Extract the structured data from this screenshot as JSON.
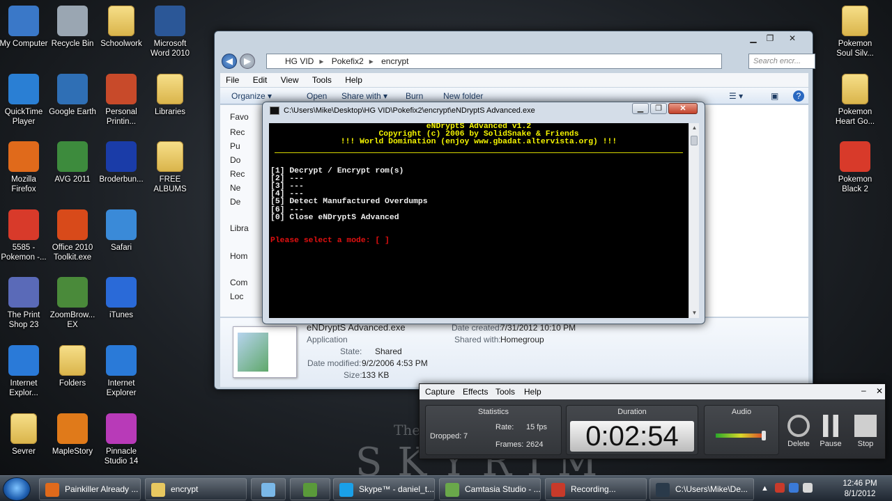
{
  "desktop": {
    "left_icons": [
      {
        "label": "My Computer",
        "color": "#3a78c8"
      },
      {
        "label": "Recycle Bin",
        "color": "#9aa6b2"
      },
      {
        "label": "Schoolwork",
        "color": "folder"
      },
      {
        "label": "Microsoft Word 2010",
        "color": "#2b5797"
      },
      {
        "label": "QuickTime Player",
        "color": "#2a7fd4"
      },
      {
        "label": "Google Earth",
        "color": "#2f6fb5"
      },
      {
        "label": "Personal Printin...",
        "color": "#c84a2a"
      },
      {
        "label": "Libraries",
        "color": "folder"
      },
      {
        "label": "Mozilla Firefox",
        "color": "#e06a1b"
      },
      {
        "label": "AVG 2011",
        "color": "#3d8b3d"
      },
      {
        "label": "Broderbun...",
        "color": "#1a3ca8"
      },
      {
        "label": "FREE ALBUMS",
        "color": "folder"
      },
      {
        "label": "5585 - Pokemon -...",
        "color": "#d83a2a"
      },
      {
        "label": "Office 2010 Toolkit.exe",
        "color": "#d84a1a"
      },
      {
        "label": "Safari",
        "color": "#3a8ad8"
      },
      {
        "label": "The Print Shop 23",
        "color": "#5a6ab8"
      },
      {
        "label": "ZoomBrow... EX",
        "color": "#4a8a3a"
      },
      {
        "label": "iTunes",
        "color": "#2a6ad8"
      },
      {
        "label": "Internet Explor...",
        "color": "#2a7ad8"
      },
      {
        "label": "Folders",
        "color": "folder"
      },
      {
        "label": "Internet Explorer",
        "color": "#2a7ad8"
      },
      {
        "label": "Sevrer",
        "color": "folder"
      },
      {
        "label": "MapleStory",
        "color": "#e07a1a"
      },
      {
        "label": "Pinnacle Studio 14",
        "color": "#b83ab8"
      }
    ],
    "right_icons": [
      {
        "label": "Pokemon Soul Silv...",
        "color": "folder"
      },
      {
        "label": "Pokemon Heart Go...",
        "color": "folder"
      },
      {
        "label": "Pokemon Black 2",
        "color": "#d83a2a"
      }
    ],
    "wallpaper_small": "The",
    "wallpaper_big": "SKYRIM"
  },
  "explorer": {
    "path": [
      "HG VID",
      "Pokefix2",
      "encrypt"
    ],
    "search_placeholder": "Search encr...",
    "menu": [
      "File",
      "Edit",
      "View",
      "Tools",
      "Help"
    ],
    "toolbar": [
      "Organize ▾",
      "Open",
      "Share with ▾",
      "Burn",
      "New folder"
    ],
    "nav_items": [
      "Favo",
      "Rec",
      "Pu",
      "Do",
      "Rec",
      "Ne",
      "De",
      "Libra",
      "Hom",
      "Com",
      "Loc"
    ],
    "details": {
      "name": "eNDryptS Advanced.exe",
      "type": "Application",
      "state_label": "State:",
      "state_value": "Shared",
      "modified_label": "Date modified:",
      "modified_value": "9/2/2006 4:53 PM",
      "size_label": "Size:",
      "size_value": "133 KB",
      "created_label": "Date created:",
      "created_value": "7/31/2012 10:10 PM",
      "shared_label": "Shared with:",
      "shared_value": "Homegroup"
    }
  },
  "console": {
    "title": "C:\\Users\\Mike\\Desktop\\HG VID\\Pokefix2\\encrypt\\eNDryptS Advanced.exe",
    "header": [
      "eNDryptS Advanced v1.2",
      "Copyright (c) 2006 by SolidSnake & Friends",
      "!!! World Domination (enjoy www.gbadat.altervista.org) !!!"
    ],
    "options": [
      "[1] Decrypt / Encrypt rom(s)",
      "[2] ---",
      "[3] ---",
      "[4] ---",
      "[5] Detect Manufactured Overdumps",
      "[6] ---",
      "[0] Close eNDryptS Advanced"
    ],
    "prompt": "Please select a mode: [ ]"
  },
  "recorder": {
    "menu": [
      "Capture",
      "Effects",
      "Tools",
      "Help"
    ],
    "statistics_title": "Statistics",
    "dropped_label": "Dropped:",
    "dropped_value": "7",
    "rate_label": "Rate:",
    "rate_value": "15 fps",
    "frames_label": "Frames:",
    "frames_value": "2624",
    "duration_title": "Duration",
    "duration_value": "0:02:54",
    "audio_title": "Audio",
    "buttons": [
      "Delete",
      "Pause",
      "Stop"
    ]
  },
  "taskbar": {
    "items": [
      {
        "label": "Painkiller Already ...",
        "color": "#e06a1b"
      },
      {
        "label": "encrypt",
        "color": "#e8c860"
      },
      {
        "label": "",
        "color": "#7ab8e8"
      },
      {
        "label": "",
        "color": "#5a9a3a"
      },
      {
        "label": "Skype™ - daniel_t...",
        "color": "#1aa0e8"
      },
      {
        "label": "Camtasia Studio - ...",
        "color": "#6aa84a"
      },
      {
        "label": "Recording...",
        "color": "#c83a2a"
      },
      {
        "label": "C:\\Users\\Mike\\De...",
        "color": "#2a3a4a"
      }
    ],
    "time": "12:46 PM",
    "date": "8/1/2012"
  }
}
